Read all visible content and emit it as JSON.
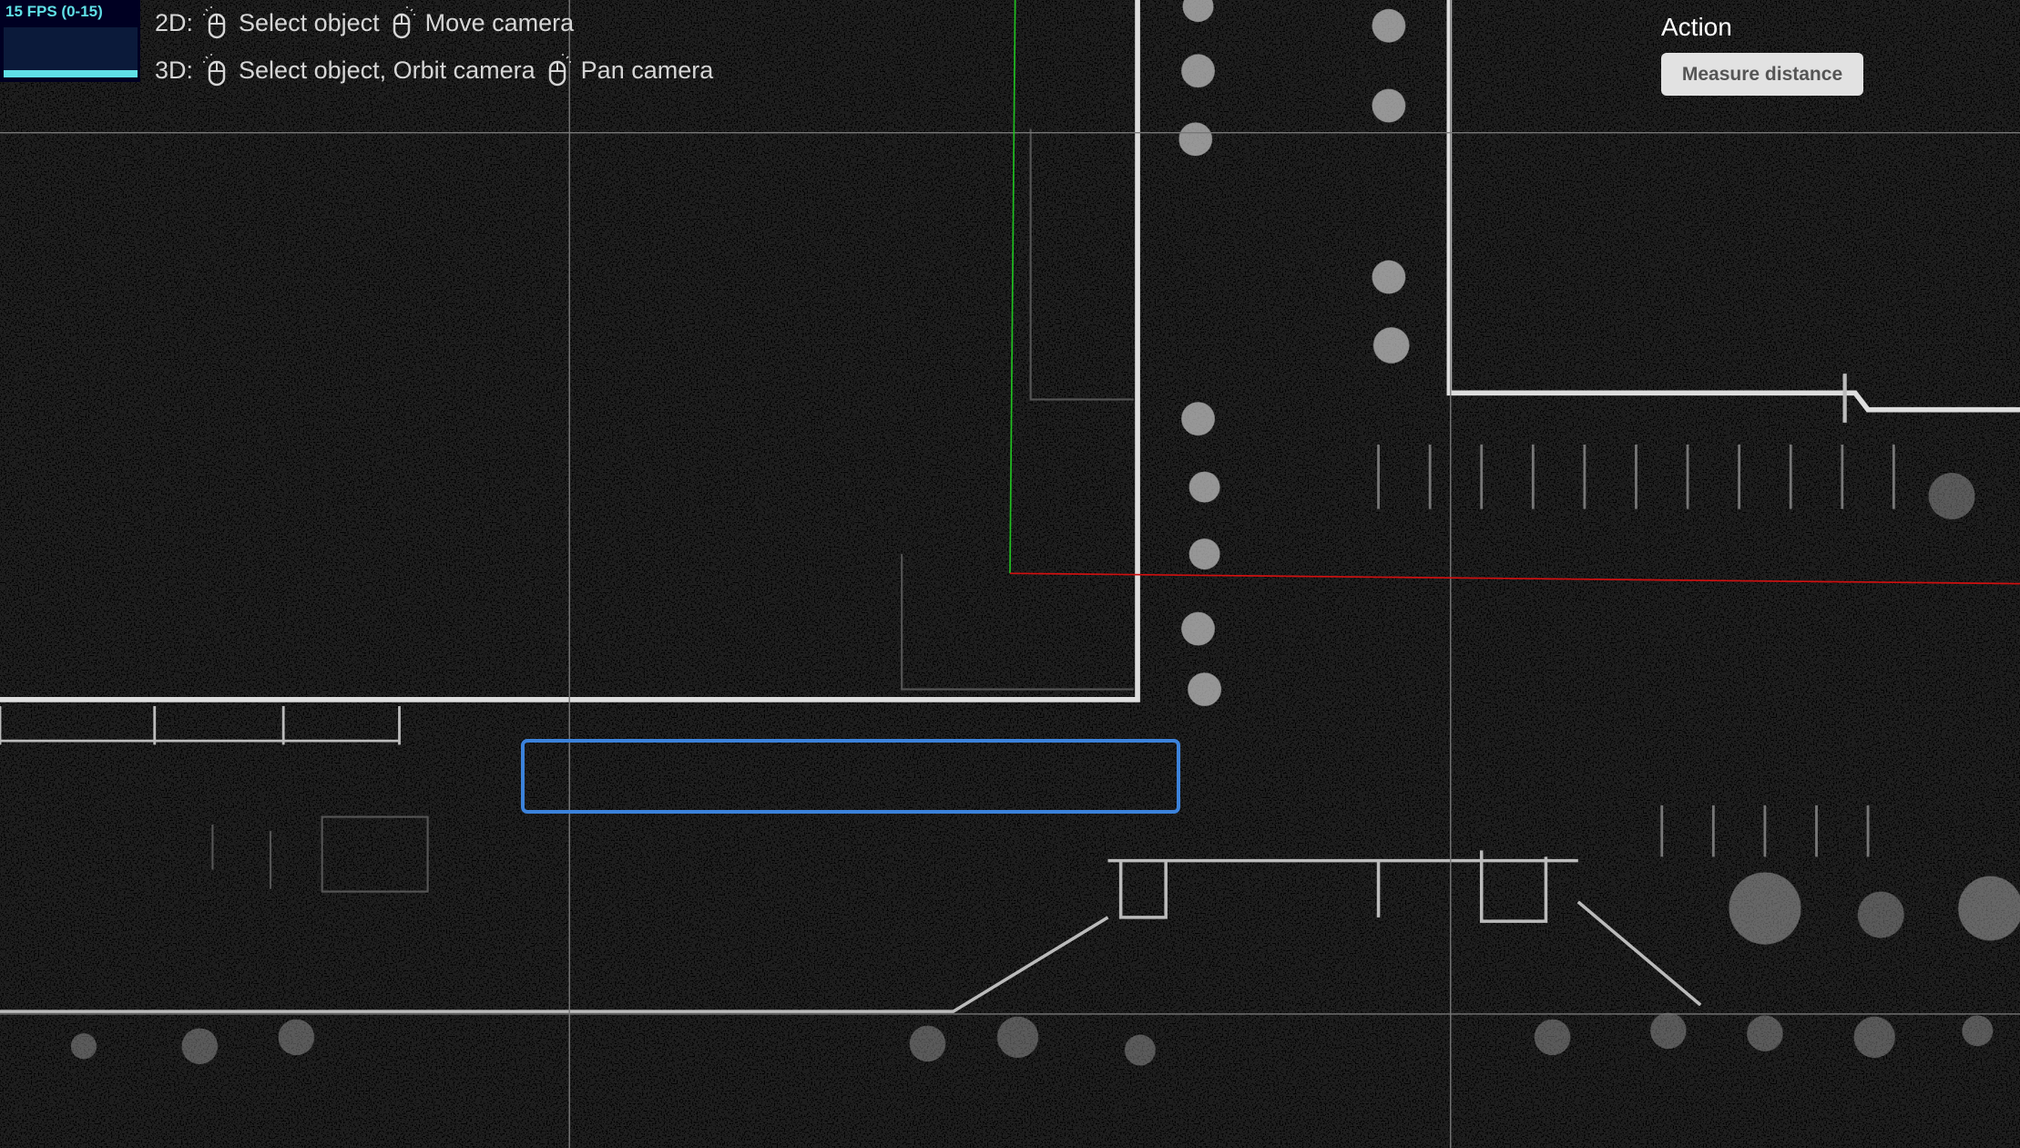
{
  "fps": {
    "label": "15 FPS (0-15)"
  },
  "controls": {
    "line_2d": {
      "prefix": "2D:",
      "left_click": "Select object",
      "right_click": "Move camera"
    },
    "line_3d": {
      "prefix": "3D:",
      "left_click": "Select object, Orbit camera",
      "right_click": "Pan camera"
    }
  },
  "action_panel": {
    "title": "Action",
    "measure_button": "Measure distance"
  },
  "colors": {
    "x_axis": "#d01010",
    "y_axis": "#20c020",
    "selection": "#3b82db",
    "fps_text": "#5fe0e6",
    "grid": "#777777"
  },
  "icons": {
    "left_click": "mouse-left-click-icon",
    "right_click": "mouse-right-click-icon"
  }
}
